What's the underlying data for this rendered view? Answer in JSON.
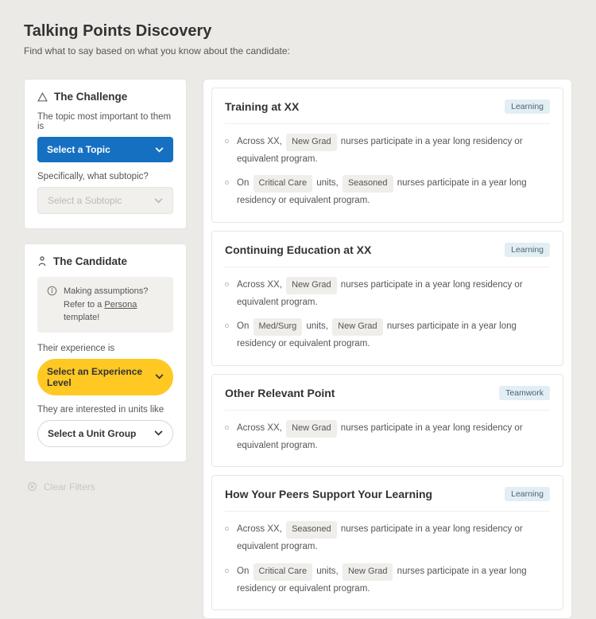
{
  "header": {
    "title": "Talking Points Discovery",
    "subtitle": "Find what to say based on what you know about the candidate:"
  },
  "sidebar": {
    "challenge": {
      "heading": "The Challenge",
      "topic_label": "The topic most important to them is",
      "topic_select": "Select a Topic",
      "subtopic_label": "Specifically, what subtopic?",
      "subtopic_select": "Select a Subtopic"
    },
    "candidate": {
      "heading": "The Candidate",
      "info_line1": "Making assumptions?",
      "info_line2_prefix": "Refer to a ",
      "info_link": "Persona",
      "info_line2_suffix": " template!",
      "experience_label": "Their experience is",
      "experience_select": "Select an Experience Level",
      "unit_label": "They are interested in units like",
      "unit_select": "Select a Unit Group"
    },
    "clear_filters": "Clear Filters"
  },
  "results": [
    {
      "title": "Training at XX",
      "tag": "Learning",
      "bullets": [
        {
          "pre": "Across XX, ",
          "chip1": "New Grad",
          "mid": " nurses participate in a year long residency or equivalent program."
        },
        {
          "pre": "On ",
          "chip1": "Critical Care",
          "mid": " units, ",
          "chip2": "Seasoned",
          "post": " nurses participate in a year long residency or equivalent program."
        }
      ]
    },
    {
      "title": "Continuing Education at XX",
      "tag": "Learning",
      "bullets": [
        {
          "pre": "Across XX, ",
          "chip1": "New Grad",
          "mid": " nurses participate in a year long residency or equivalent program."
        },
        {
          "pre": "On ",
          "chip1": "Med/Surg",
          "mid": " units, ",
          "chip2": "New Grad",
          "post": " nurses participate in a year long residency or equivalent program."
        }
      ]
    },
    {
      "title": "Other Relevant Point",
      "tag": "Teamwork",
      "bullets": [
        {
          "pre": "Across XX, ",
          "chip1": "New Grad",
          "mid": " nurses participate in a year long residency or equivalent program."
        }
      ]
    },
    {
      "title": "How Your Peers Support Your Learning",
      "tag": "Learning",
      "bullets": [
        {
          "pre": "Across XX, ",
          "chip1": "Seasoned",
          "mid": " nurses participate in a year long residency or equivalent program."
        },
        {
          "pre": "On ",
          "chip1": "Critical Care",
          "mid": " units, ",
          "chip2": "New Grad",
          "post": " nurses participate in a year long residency or equivalent program."
        }
      ]
    }
  ]
}
